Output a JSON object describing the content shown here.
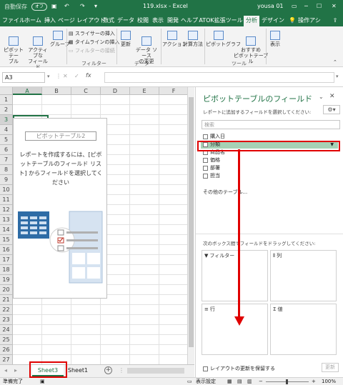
{
  "titlebar": {
    "autosave": "自動保存",
    "autosave_state": "オフ",
    "filename": "119.xlsx - Excel",
    "user": "yousa 01"
  },
  "tabs": [
    "ファイル",
    "ホーム",
    "挿入",
    "ページ レイアウト",
    "数式",
    "データ",
    "校閲",
    "表示",
    "開発",
    "ヘルプ",
    "ATOK拡張ツール",
    "分析",
    "デザイン"
  ],
  "active_tab": "分析",
  "tell_me": "操作アシ",
  "ribbon": {
    "pivot_table": "ピボットテー\nブル",
    "active_field": "アクティブな\nフィールド",
    "group": "グループ",
    "slicer": "スライサーの挿入",
    "timeline": "タイムラインの挿入",
    "filter_conn": "フィルターの接続",
    "filter_group": "フィルター",
    "refresh": "更新",
    "change_source": "データ ソース\nの変更",
    "data_group": "データ",
    "actions": "アクション",
    "calc": "計算方法",
    "pivot_chart": "ピボットグラフ",
    "recommended": "おすすめ\nピボットテーブル",
    "tools_group": "ツール",
    "show": "表示"
  },
  "formula_bar": {
    "name_box": "A3",
    "fx": "fx",
    "value": ""
  },
  "grid": {
    "columns": [
      "A",
      "B",
      "C",
      "D",
      "E",
      "F"
    ],
    "rows": [
      "1",
      "2",
      "3",
      "4",
      "5",
      "6",
      "7",
      "8",
      "9",
      "10",
      "11",
      "12",
      "13",
      "14",
      "15",
      "16",
      "17",
      "18",
      "19",
      "20",
      "21",
      "22",
      "23",
      "24",
      "25",
      "26",
      "27"
    ],
    "selected_col": "A",
    "selected_row": "3"
  },
  "pivot_placeholder": {
    "title": "ピボットテーブル2",
    "text": "レポートを作成するには、[ピボットテーブルのフィールド リスト] からフィールドを選択してください"
  },
  "sheets": [
    "Sheet3",
    "Sheet1"
  ],
  "active_sheet": "Sheet3",
  "status": {
    "ready": "準備完了",
    "display": "表示設定",
    "zoom": "100%"
  },
  "pane": {
    "title": "ピボットテーブルのフィールド",
    "subtitle": "レポートに追加するフィールドを選択してください:",
    "search_placeholder": "検索",
    "fields": [
      "購入日",
      "分類",
      "商品名",
      "価格",
      "部署",
      "担当"
    ],
    "highlighted_field": "分類",
    "more_tables": "その他のテーブル...",
    "areas_label": "次のボックス間でフィールドをドラッグしてください:",
    "area_filter": "フィルター",
    "area_columns": "列",
    "area_rows": "行",
    "area_values": "値",
    "defer_label": "レイアウトの更新を保留する",
    "update_button": "更新"
  },
  "colors": {
    "accent": "#217346",
    "highlight": "#e00000",
    "field_hl": "#a6d1b5"
  }
}
